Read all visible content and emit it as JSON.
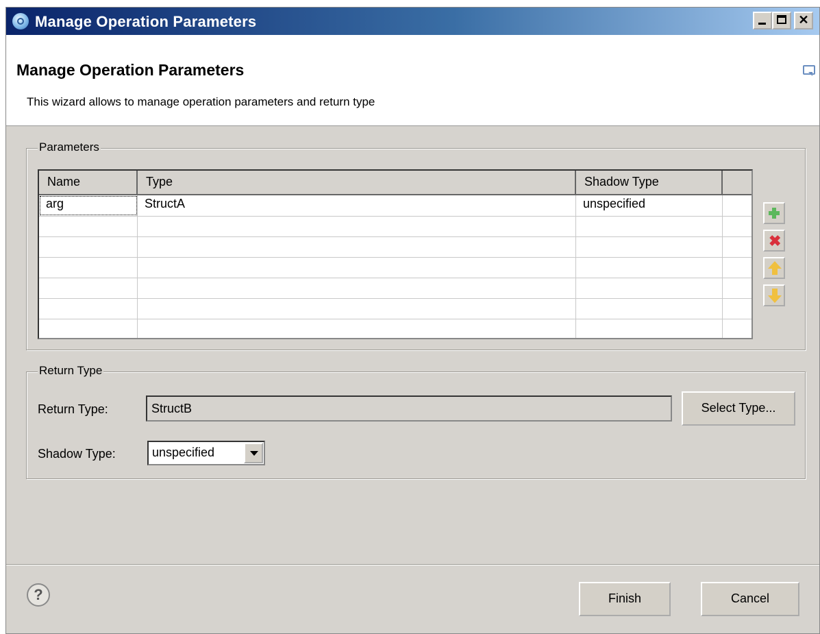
{
  "window": {
    "title": "Manage Operation Parameters"
  },
  "header": {
    "title": "Manage Operation Parameters",
    "description": "This wizard allows to manage operation parameters and return type"
  },
  "parameters": {
    "group_label": "Parameters",
    "columns": [
      "Name",
      "Type",
      "Shadow Type"
    ],
    "rows": [
      {
        "name": "arg",
        "type": "StructA",
        "shadow_type": "unspecified"
      }
    ],
    "actions": [
      "add-icon",
      "remove-icon",
      "move-up-icon",
      "move-down-icon"
    ]
  },
  "return_type": {
    "group_label": "Return Type",
    "return_type_label": "Return Type:",
    "return_type_value": "StructB",
    "select_type_button": "Select Type...",
    "shadow_type_label": "Shadow Type:",
    "shadow_type_value": "unspecified"
  },
  "footer": {
    "help_glyph": "?",
    "finish_button": "Finish",
    "cancel_button": "Cancel"
  }
}
